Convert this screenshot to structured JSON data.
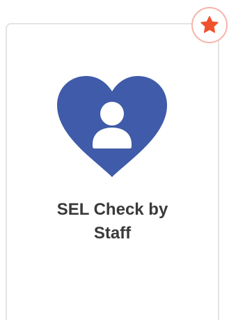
{
  "card": {
    "title_line1": "SEL Check by",
    "title_line2": "Staff",
    "icon": "heart-person-icon",
    "icon_color": "#3f5ba9"
  },
  "favorite": {
    "icon": "star-icon",
    "color": "#f0522e",
    "ring_color": "#f6b3a8"
  }
}
